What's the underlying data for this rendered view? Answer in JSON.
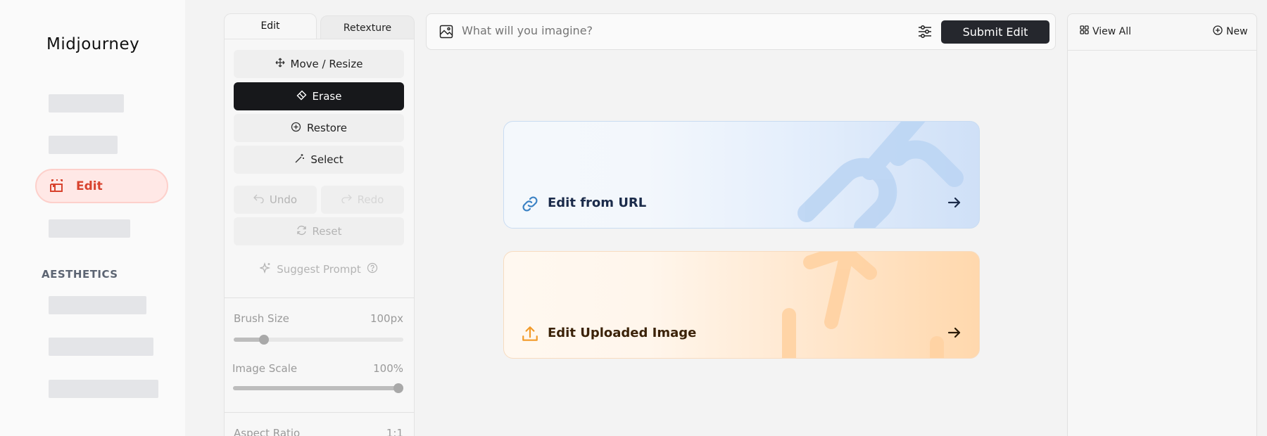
{
  "sidebar": {
    "logo": "Midjourney",
    "edit_label": "Edit",
    "section_title": "AESTHETICS"
  },
  "tools": {
    "tabs": [
      "Edit",
      "Retexture"
    ],
    "move_resize": "Move / Resize",
    "erase": "Erase",
    "restore": "Restore",
    "select": "Select",
    "undo": "Undo",
    "redo": "Redo",
    "reset": "Reset",
    "suggest_prompt": "Suggest Prompt",
    "brush_size_label": "Brush Size",
    "brush_size_value": "100px",
    "brush_size_fraction": 0.18,
    "image_scale_label": "Image Scale",
    "image_scale_value": "100%",
    "image_scale_fraction": 1.0,
    "aspect_ratio_label": "Aspect Ratio",
    "aspect_ratio_value": "1:1"
  },
  "prompt": {
    "placeholder": "What will you imagine?",
    "submit": "Submit Edit"
  },
  "cards": {
    "url_label": "Edit from URL",
    "upload_label": "Edit Uploaded Image"
  },
  "right_panel": {
    "view_all": "View All",
    "new": "New"
  },
  "colors": {
    "accent_red": "#d8432e",
    "dark": "#17181b",
    "url_icon": "#3b82c4",
    "upload_icon": "#f29a28"
  }
}
